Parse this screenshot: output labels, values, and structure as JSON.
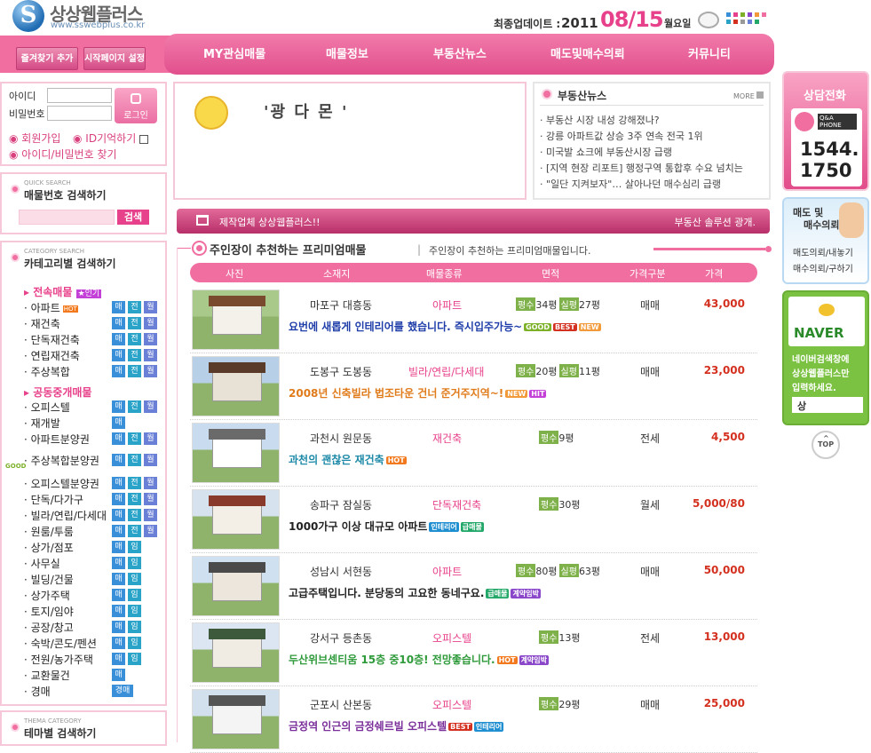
{
  "logo": {
    "name": "상상웹플러스",
    "url": "www.sswebplus.co.kr"
  },
  "update": {
    "label": "최종업데이트 :",
    "year": "2011",
    "date": "08/15",
    "weekday": "월요일"
  },
  "top_buttons": {
    "bookmark": "즐겨찾기 추가",
    "homepage": "시작페이지 설정"
  },
  "menu": [
    "MY관심매물",
    "매물정보",
    "부동산뉴스",
    "매도및매수의뢰",
    "커뮤니티"
  ],
  "login": {
    "id_label": "아이디",
    "pw_label": "비밀번호",
    "button": "로그인",
    "join": "회원가입",
    "remember": "ID기억하기",
    "find": "아이디/비밀번호 찾기"
  },
  "quick_search": {
    "small": "QUICK SEARCH",
    "title": "매물번호 검색하기",
    "button": "검색"
  },
  "category": {
    "small": "CATEGORY SEARCH",
    "title": "카테고리별 검색하기",
    "sec1": "전속매물",
    "sec1_badge": "★인기",
    "items1": [
      {
        "label": "아파트",
        "hot": "HOT",
        "tags": [
          "매",
          "전",
          "월"
        ]
      },
      {
        "label": "재건축",
        "tags": [
          "매",
          "전",
          "월"
        ]
      },
      {
        "label": "단독재건축",
        "tags": [
          "매",
          "전",
          "월"
        ]
      },
      {
        "label": "연립재건축",
        "tags": [
          "매",
          "전",
          "월"
        ]
      },
      {
        "label": "주상복합",
        "tags": [
          "매",
          "전",
          "월"
        ]
      }
    ],
    "sec2": "공동중개매물",
    "items2": [
      {
        "label": "오피스텔",
        "tags": [
          "매",
          "전",
          "월"
        ]
      },
      {
        "label": "재개발",
        "tags": [
          "매"
        ]
      },
      {
        "label": "아파트분양권",
        "tags": [
          "매",
          "전",
          "월"
        ]
      },
      {
        "label": "주상복합분양권",
        "tags": [
          "매",
          "전",
          "월"
        ]
      },
      {
        "label": "오피스텔분양권",
        "tags": [
          "매",
          "전",
          "월"
        ]
      },
      {
        "label": "단독/다가구",
        "tags": [
          "매",
          "전",
          "월"
        ]
      },
      {
        "label": "빌라/연립/다세대",
        "tags": [
          "매",
          "전",
          "월"
        ]
      },
      {
        "label": "원룸/투룸",
        "tags": [
          "매",
          "전",
          "월"
        ]
      },
      {
        "label": "상가/점포",
        "tags": [
          "매",
          "임"
        ]
      },
      {
        "label": "사무실",
        "tags": [
          "매",
          "임"
        ]
      },
      {
        "label": "빌딩/건물",
        "tags": [
          "매",
          "임"
        ]
      },
      {
        "label": "상가주택",
        "tags": [
          "매",
          "임"
        ]
      },
      {
        "label": "토지/임야",
        "tags": [
          "매",
          "임"
        ]
      },
      {
        "label": "공장/창고",
        "tags": [
          "매",
          "임"
        ]
      },
      {
        "label": "숙박/콘도/펜션",
        "tags": [
          "매",
          "임"
        ]
      },
      {
        "label": "전원/농가주택",
        "tags": [
          "매",
          "임"
        ]
      },
      {
        "label": "교환물건",
        "tags": [
          "매"
        ]
      },
      {
        "label": "경매",
        "tags": [
          "경매"
        ]
      }
    ],
    "good": "GOOD"
  },
  "theme": {
    "small": "THEMA CATEGORY",
    "title": "테마별 검색하기"
  },
  "banner_text": "'광  다  몬  '",
  "news": {
    "title": "부동산뉴스",
    "more": "MORE",
    "items": [
      "부동산 시장 내성 강해졌나?",
      "강릉 아파트값 상승 3주 연속 전국 1위",
      "미국발 쇼크에 부동산시장 급랭",
      "[지역 현장 리포트] 행정구역 통합후 수요 넘치는",
      "\"일단 지켜보자\"… 살아나던 매수심리 급랭"
    ]
  },
  "ticker": {
    "left": "제작업체 상상웹플러스!!",
    "right": "부동산 솔루션 광개."
  },
  "section": {
    "title": "주인장이 추천하는 프리미엄매물",
    "subtitle": "주인장이 추천하는 프리미엄매물입니다."
  },
  "table_headers": [
    "사진",
    "소재지",
    "매물종류",
    "면적",
    "가격구분",
    "가격"
  ],
  "area_labels": {
    "supply": "평수",
    "actual": "실평"
  },
  "listings": [
    {
      "loc": "마포구 대흥동",
      "type": "아파트",
      "area1": "34평",
      "area2": "27평",
      "deal": "매매",
      "price": "43,000",
      "desc": "요번에 새롭게 인테리어를 했습니다. 즉시입주가능~",
      "desc_color": "#1e3da8",
      "tags": [
        [
          "GOOD",
          "#7bb027"
        ],
        [
          "BEST",
          "#d4301f"
        ],
        [
          "NEW",
          "#f29a3a"
        ]
      ]
    },
    {
      "loc": "도봉구 도봉동",
      "type": "빌라/연립/다세대",
      "area1": "20평",
      "area2": "11평",
      "deal": "매매",
      "price": "23,000",
      "desc": "2008년 신축빌라 법조타운 건너 준거주지역~!",
      "desc_color": "#e07b1b",
      "tags": [
        [
          "NEW",
          "#f29a3a"
        ],
        [
          "HIT",
          "#c441d8"
        ]
      ]
    },
    {
      "loc": "과천시 원문동",
      "type": "재건축",
      "area1": "9평",
      "area2": "",
      "deal": "전세",
      "price": "4,500",
      "desc": "과천의 괜찮은 재건축",
      "desc_color": "#1e8aa8",
      "tags": [
        [
          "HOT",
          "#f2791e"
        ]
      ]
    },
    {
      "loc": "송파구 잠실동",
      "type": "단독재건축",
      "area1": "30평",
      "area2": "",
      "deal": "월세",
      "price": "5,000/80",
      "desc": "1000가구 이상 대규모 아파트",
      "desc_color": "#222222",
      "tags": [
        [
          "인테리어",
          "#1f8fd1"
        ],
        [
          "급매물",
          "#23a86a"
        ]
      ]
    },
    {
      "loc": "성남시 서현동",
      "type": "아파트",
      "area1": "80평",
      "area2": "63평",
      "deal": "매매",
      "price": "50,000",
      "desc": "고급주택입니다. 분당동의 고요한 동네구요.",
      "desc_color": "#222222",
      "tags": [
        [
          "급매물",
          "#23a86a"
        ],
        [
          "계약임박",
          "#8a47c9"
        ]
      ]
    },
    {
      "loc": "강서구 등촌동",
      "type": "오피스텔",
      "area1": "13평",
      "area2": "",
      "deal": "전세",
      "price": "13,000",
      "desc": "두산위브센티움 15층 중10층! 전망좋습니다.",
      "desc_color": "#2e9a3a",
      "tags": [
        [
          "HOT",
          "#f2791e"
        ],
        [
          "계약임박",
          "#8a47c9"
        ]
      ]
    },
    {
      "loc": "군포시 산본동",
      "type": "오피스텔",
      "area1": "29평",
      "area2": "",
      "deal": "매매",
      "price": "25,000",
      "desc": "금정역 인근의 금정쉐르빌 오피스텔",
      "desc_color": "#7a2e9a",
      "tags": [
        [
          "BEST",
          "#d4301f"
        ],
        [
          "인테리어",
          "#1f8fd1"
        ]
      ]
    }
  ],
  "right": {
    "call_title": "상담전화",
    "qa": "Q&A PHONE",
    "phone1": "1544.",
    "phone2": "1750",
    "req_title1": "매도 및",
    "req_title2": "매수의뢰",
    "req1": "매도의뢰/내놓기",
    "req2": "매수의뢰/구하기",
    "naver": "NAVER",
    "naver_text1": "네이버검색창에",
    "naver_text2": "상상웹플러스만",
    "naver_text3": "입력하세요.",
    "naver_input": "상",
    "top": "TOP"
  },
  "colors": {
    "pink": "#f06fa0",
    "dark_pink": "#e8418b",
    "price": "#d4301f"
  }
}
